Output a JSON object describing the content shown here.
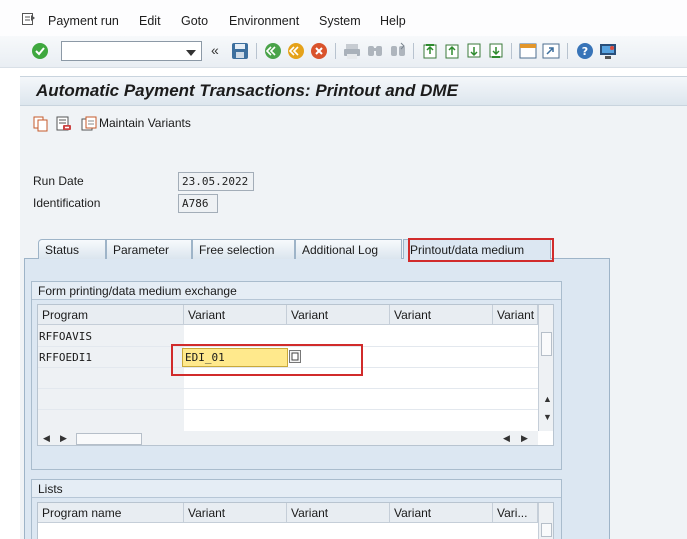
{
  "menu": {
    "items": [
      {
        "label": "Payment run"
      },
      {
        "label": "Edit"
      },
      {
        "label": "Goto"
      },
      {
        "label": "Environment"
      },
      {
        "label": "System"
      },
      {
        "label": "Help"
      }
    ]
  },
  "toolbar": {
    "command_field_value": "",
    "icons": [
      "enter-icon",
      "command-dropdown-icon",
      "back-arrows-icon",
      "save-icon",
      "back-icon",
      "exit-icon",
      "cancel-icon",
      "print-icon",
      "find-icon",
      "find-next-icon",
      "first-page-icon",
      "previous-page-icon",
      "next-page-icon",
      "last-page-icon",
      "new-session-icon",
      "shortcut-icon",
      "help-icon",
      "layout-icon"
    ]
  },
  "title": "Automatic Payment Transactions: Printout and DME",
  "app_toolbar": {
    "maintain_variants_label": "Maintain Variants"
  },
  "header_fields": {
    "run_date_label": "Run Date",
    "run_date_value": "23.05.2022",
    "identification_label": "Identification",
    "identification_value": "A786"
  },
  "tabs": [
    {
      "label": "Status"
    },
    {
      "label": "Parameter"
    },
    {
      "label": "Free selection"
    },
    {
      "label": "Additional Log"
    },
    {
      "label": "Printout/data medium",
      "active": true
    }
  ],
  "form_printing": {
    "title": "Form printing/data medium exchange",
    "columns": [
      "Program",
      "Variant",
      "Variant",
      "Variant",
      "Variant"
    ],
    "rows": [
      {
        "program": "RFFOAVIS",
        "variant": ""
      },
      {
        "program": "RFFOEDI1",
        "variant": "EDI_01"
      }
    ]
  },
  "lists": {
    "title": "Lists",
    "columns": [
      "Program name",
      "Variant",
      "Variant",
      "Variant",
      "Vari..."
    ]
  },
  "colors": {
    "highlight_red": "#d12b2b",
    "tab_panel": "#dce7f2",
    "selected_field": "#ffe98c"
  }
}
